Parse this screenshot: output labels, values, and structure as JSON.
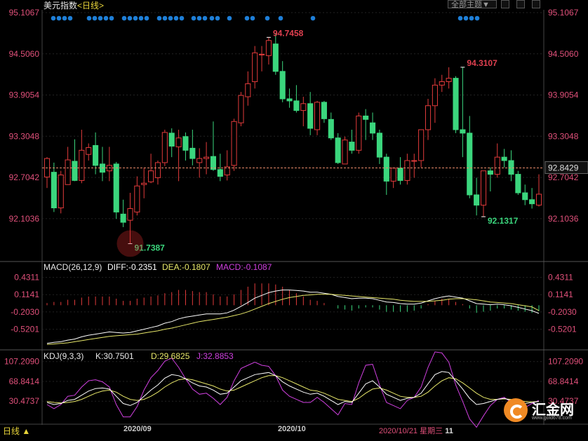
{
  "header": {
    "title": "美元指数",
    "period_tag": "<日线>",
    "filter_label": "全部主题▼"
  },
  "colors": {
    "up": "#e23b3b",
    "down": "#3bd67d",
    "background": "#000000",
    "diff": "#ffffff",
    "dea": "#e8e86a",
    "macd_pos": "#e23b3b",
    "macd_neg": "#3bd67d",
    "k": "#ffffff",
    "d": "#e8e86a",
    "j": "#d040e0",
    "dots": "#1e7fd8",
    "lastline": "#e88a6a"
  },
  "chart_data": [
    {
      "type": "candlestick",
      "title": "美元指数",
      "y_ticks": [
        "95.1067",
        "94.5060",
        "93.9054",
        "93.3048",
        "92.7042",
        "92.1036"
      ],
      "ylim": [
        91.55,
        95.1067
      ],
      "last_price": "92.8429",
      "annotations": {
        "high": "94.7458",
        "low": "91.7387",
        "local_high": "94.3107",
        "local_low": "92.1317"
      },
      "x_labels": [
        "2020/09",
        "2020/10"
      ],
      "cursor_label": {
        "date": "2020/10/21",
        "weekday": "星期三",
        "hour": "11"
      },
      "candles": [
        {
          "o": 92.71,
          "h": 93.0,
          "l": 92.55,
          "c": 92.98
        },
        {
          "o": 92.78,
          "h": 92.92,
          "l": 92.2,
          "c": 92.26
        },
        {
          "o": 92.26,
          "h": 92.8,
          "l": 92.18,
          "c": 92.74
        },
        {
          "o": 92.6,
          "h": 93.15,
          "l": 92.6,
          "c": 92.96
        },
        {
          "o": 92.94,
          "h": 93.26,
          "l": 92.65,
          "c": 92.66
        },
        {
          "o": 92.66,
          "h": 93.4,
          "l": 92.62,
          "c": 93.1
        },
        {
          "o": 93.04,
          "h": 93.2,
          "l": 92.95,
          "c": 93.14
        },
        {
          "o": 93.17,
          "h": 93.36,
          "l": 92.75,
          "c": 92.88
        },
        {
          "o": 92.9,
          "h": 93.15,
          "l": 92.65,
          "c": 92.78
        },
        {
          "o": 92.8,
          "h": 93.15,
          "l": 92.65,
          "c": 92.88
        },
        {
          "o": 92.9,
          "h": 92.93,
          "l": 92.1,
          "c": 92.2
        },
        {
          "o": 92.17,
          "h": 92.38,
          "l": 91.98,
          "c": 92.05
        },
        {
          "o": 92.08,
          "h": 92.48,
          "l": 91.74,
          "c": 92.25
        },
        {
          "o": 92.2,
          "h": 92.72,
          "l": 92.15,
          "c": 92.58
        },
        {
          "o": 92.6,
          "h": 92.85,
          "l": 92.4,
          "c": 92.62
        },
        {
          "o": 92.64,
          "h": 93.05,
          "l": 92.62,
          "c": 92.8
        },
        {
          "o": 92.7,
          "h": 92.95,
          "l": 92.6,
          "c": 92.92
        },
        {
          "o": 92.92,
          "h": 93.4,
          "l": 92.87,
          "c": 93.36
        },
        {
          "o": 93.35,
          "h": 93.42,
          "l": 93.0,
          "c": 93.16
        },
        {
          "o": 93.15,
          "h": 93.4,
          "l": 92.65,
          "c": 93.28
        },
        {
          "o": 93.3,
          "h": 93.36,
          "l": 92.95,
          "c": 93.1
        },
        {
          "o": 93.13,
          "h": 93.4,
          "l": 92.88,
          "c": 92.98
        },
        {
          "o": 92.92,
          "h": 93.13,
          "l": 92.7,
          "c": 92.98
        },
        {
          "o": 92.98,
          "h": 93.22,
          "l": 92.75,
          "c": 93.0
        },
        {
          "o": 93.01,
          "h": 93.52,
          "l": 92.8,
          "c": 92.82
        },
        {
          "o": 92.82,
          "h": 93.05,
          "l": 92.65,
          "c": 92.72
        },
        {
          "o": 92.74,
          "h": 93.1,
          "l": 92.66,
          "c": 92.86
        },
        {
          "o": 92.88,
          "h": 93.56,
          "l": 92.8,
          "c": 93.52
        },
        {
          "o": 93.5,
          "h": 93.95,
          "l": 93.45,
          "c": 93.9
        },
        {
          "o": 93.88,
          "h": 94.25,
          "l": 93.75,
          "c": 94.07
        },
        {
          "o": 94.1,
          "h": 94.62,
          "l": 94.0,
          "c": 94.52
        },
        {
          "o": 94.5,
          "h": 94.62,
          "l": 94.25,
          "c": 94.5
        },
        {
          "o": 94.48,
          "h": 94.75,
          "l": 94.35,
          "c": 94.7
        },
        {
          "o": 94.65,
          "h": 94.8,
          "l": 94.2,
          "c": 94.25
        },
        {
          "o": 94.25,
          "h": 94.4,
          "l": 93.8,
          "c": 93.85
        },
        {
          "o": 93.85,
          "h": 94.0,
          "l": 93.72,
          "c": 93.82
        },
        {
          "o": 93.82,
          "h": 94.05,
          "l": 93.65,
          "c": 93.68
        },
        {
          "o": 93.68,
          "h": 93.88,
          "l": 93.45,
          "c": 93.78
        },
        {
          "o": 93.78,
          "h": 93.95,
          "l": 93.32,
          "c": 93.42
        },
        {
          "o": 93.4,
          "h": 93.82,
          "l": 93.32,
          "c": 93.8
        },
        {
          "o": 93.8,
          "h": 93.82,
          "l": 93.5,
          "c": 93.56
        },
        {
          "o": 93.55,
          "h": 93.65,
          "l": 93.25,
          "c": 93.28
        },
        {
          "o": 93.28,
          "h": 93.35,
          "l": 92.9,
          "c": 92.92
        },
        {
          "o": 92.9,
          "h": 93.3,
          "l": 92.9,
          "c": 93.25
        },
        {
          "o": 93.22,
          "h": 93.4,
          "l": 93.05,
          "c": 93.1
        },
        {
          "o": 93.1,
          "h": 93.65,
          "l": 93.05,
          "c": 93.6
        },
        {
          "o": 93.6,
          "h": 93.7,
          "l": 93.25,
          "c": 93.55
        },
        {
          "o": 93.5,
          "h": 93.65,
          "l": 93.25,
          "c": 93.35
        },
        {
          "o": 93.35,
          "h": 93.4,
          "l": 92.9,
          "c": 93.0
        },
        {
          "o": 93.0,
          "h": 93.05,
          "l": 92.45,
          "c": 92.65
        },
        {
          "o": 92.65,
          "h": 92.85,
          "l": 92.55,
          "c": 92.84
        },
        {
          "o": 92.84,
          "h": 93.0,
          "l": 92.6,
          "c": 92.66
        },
        {
          "o": 92.66,
          "h": 93.05,
          "l": 92.6,
          "c": 92.95
        },
        {
          "o": 92.95,
          "h": 93.05,
          "l": 92.7,
          "c": 92.95
        },
        {
          "o": 92.95,
          "h": 93.35,
          "l": 92.85,
          "c": 93.4
        },
        {
          "o": 93.4,
          "h": 93.85,
          "l": 93.25,
          "c": 93.75
        },
        {
          "o": 93.75,
          "h": 94.15,
          "l": 93.5,
          "c": 94.05
        },
        {
          "o": 94.05,
          "h": 94.2,
          "l": 93.95,
          "c": 94.1
        },
        {
          "o": 94.1,
          "h": 94.31,
          "l": 94.0,
          "c": 94.15
        },
        {
          "o": 94.15,
          "h": 94.18,
          "l": 93.35,
          "c": 93.4
        },
        {
          "o": 93.4,
          "h": 94.31,
          "l": 93.0,
          "c": 93.35
        },
        {
          "o": 93.35,
          "h": 93.6,
          "l": 92.4,
          "c": 92.45
        },
        {
          "o": 92.45,
          "h": 92.7,
          "l": 92.15,
          "c": 92.3
        },
        {
          "o": 92.3,
          "h": 92.8,
          "l": 92.13,
          "c": 92.8
        },
        {
          "o": 92.8,
          "h": 92.85,
          "l": 92.5,
          "c": 92.75
        },
        {
          "o": 92.75,
          "h": 93.2,
          "l": 92.7,
          "c": 93.0
        },
        {
          "o": 93.0,
          "h": 93.12,
          "l": 92.85,
          "c": 92.95
        },
        {
          "o": 92.95,
          "h": 93.1,
          "l": 92.65,
          "c": 92.75
        },
        {
          "o": 92.75,
          "h": 92.8,
          "l": 92.45,
          "c": 92.48
        },
        {
          "o": 92.48,
          "h": 92.6,
          "l": 92.3,
          "c": 92.38
        },
        {
          "o": 92.38,
          "h": 92.55,
          "l": 92.25,
          "c": 92.32
        },
        {
          "o": 92.3,
          "h": 92.75,
          "l": 92.28,
          "c": 92.46
        }
      ]
    },
    {
      "type": "line",
      "title": "MACD(26,12,9)",
      "legend": [
        {
          "label": "DIFF:",
          "value": "-0.2351"
        },
        {
          "label": "DEA:",
          "value": "-0.1807"
        },
        {
          "label": "MACD:",
          "value": "-0.1087"
        }
      ],
      "y_ticks": [
        "0.4311",
        "0.1141",
        "-0.2030",
        "-0.5201"
      ],
      "ylim": [
        -0.86,
        0.58
      ],
      "diff": [
        -0.78,
        -0.76,
        -0.75,
        -0.72,
        -0.7,
        -0.66,
        -0.63,
        -0.61,
        -0.59,
        -0.57,
        -0.58,
        -0.59,
        -0.58,
        -0.55,
        -0.52,
        -0.49,
        -0.46,
        -0.41,
        -0.38,
        -0.33,
        -0.3,
        -0.28,
        -0.26,
        -0.24,
        -0.24,
        -0.24,
        -0.22,
        -0.17,
        -0.1,
        -0.03,
        0.05,
        0.1,
        0.15,
        0.18,
        0.2,
        0.2,
        0.19,
        0.18,
        0.16,
        0.16,
        0.14,
        0.12,
        0.08,
        0.06,
        0.04,
        0.05,
        0.05,
        0.04,
        0.01,
        -0.02,
        -0.03,
        -0.05,
        -0.06,
        -0.06,
        -0.04,
        0.0,
        0.04,
        0.07,
        0.09,
        0.07,
        0.05,
        0.0,
        -0.05,
        -0.06,
        -0.07,
        -0.06,
        -0.07,
        -0.09,
        -0.12,
        -0.15,
        -0.18,
        -0.23
      ],
      "dea": [
        -0.8,
        -0.79,
        -0.78,
        -0.77,
        -0.75,
        -0.73,
        -0.71,
        -0.69,
        -0.67,
        -0.65,
        -0.64,
        -0.63,
        -0.62,
        -0.61,
        -0.59,
        -0.57,
        -0.55,
        -0.52,
        -0.5,
        -0.47,
        -0.44,
        -0.41,
        -0.38,
        -0.36,
        -0.34,
        -0.32,
        -0.3,
        -0.27,
        -0.24,
        -0.2,
        -0.15,
        -0.1,
        -0.05,
        -0.01,
        0.03,
        0.06,
        0.08,
        0.1,
        0.11,
        0.12,
        0.12,
        0.12,
        0.11,
        0.1,
        0.09,
        0.08,
        0.07,
        0.06,
        0.05,
        0.04,
        0.03,
        0.01,
        0.0,
        -0.01,
        -0.01,
        -0.01,
        0.0,
        0.01,
        0.03,
        0.04,
        0.04,
        0.03,
        0.02,
        0.0,
        -0.02,
        -0.03,
        -0.04,
        -0.05,
        -0.07,
        -0.09,
        -0.11,
        -0.18
      ],
      "macd": [
        0.04,
        0.06,
        0.06,
        0.1,
        0.1,
        0.14,
        0.16,
        0.16,
        0.16,
        0.16,
        0.12,
        0.08,
        0.08,
        0.12,
        0.14,
        0.16,
        0.18,
        0.22,
        0.24,
        0.28,
        0.28,
        0.26,
        0.24,
        0.24,
        0.2,
        0.16,
        0.16,
        0.2,
        0.28,
        0.34,
        0.4,
        0.4,
        0.4,
        0.38,
        0.34,
        0.28,
        0.22,
        0.16,
        0.1,
        0.08,
        0.04,
        0.0,
        -0.06,
        -0.08,
        -0.1,
        -0.06,
        -0.04,
        -0.04,
        -0.08,
        -0.12,
        -0.12,
        -0.12,
        -0.12,
        -0.1,
        -0.06,
        0.02,
        0.08,
        0.12,
        0.12,
        0.06,
        0.02,
        -0.06,
        -0.14,
        -0.12,
        -0.1,
        -0.06,
        -0.06,
        -0.08,
        -0.1,
        -0.12,
        -0.14,
        -0.11
      ]
    },
    {
      "type": "line",
      "title": "KDJ(9,3,3)",
      "legend": [
        {
          "label": "K:",
          "value": "30.7501"
        },
        {
          "label": "D:",
          "value": "29.6825"
        },
        {
          "label": "J:",
          "value": "32.8853"
        }
      ],
      "y_ticks": [
        "107.2090",
        "68.8414",
        "30.4737"
      ],
      "ylim": [
        -10,
        115
      ],
      "k": [
        28,
        24,
        26,
        32,
        34,
        42,
        50,
        55,
        56,
        54,
        40,
        26,
        22,
        28,
        40,
        52,
        62,
        75,
        82,
        80,
        74,
        66,
        60,
        58,
        52,
        44,
        46,
        58,
        70,
        76,
        82,
        84,
        86,
        80,
        68,
        60,
        54,
        48,
        44,
        46,
        40,
        32,
        24,
        30,
        28,
        46,
        64,
        70,
        58,
        44,
        38,
        32,
        36,
        38,
        46,
        64,
        82,
        88,
        86,
        70,
        54,
        36,
        24,
        26,
        30,
        34,
        36,
        32,
        28,
        26,
        28,
        30
      ],
      "d": [
        30,
        28,
        27,
        28,
        30,
        34,
        40,
        46,
        50,
        52,
        48,
        40,
        34,
        32,
        34,
        40,
        48,
        58,
        66,
        72,
        74,
        72,
        68,
        64,
        60,
        54,
        50,
        52,
        58,
        64,
        70,
        76,
        80,
        80,
        76,
        70,
        64,
        58,
        52,
        50,
        46,
        40,
        34,
        32,
        30,
        36,
        46,
        54,
        56,
        52,
        46,
        40,
        38,
        38,
        40,
        48,
        60,
        70,
        76,
        74,
        66,
        56,
        46,
        38,
        34,
        34,
        35,
        34,
        32,
        30,
        29,
        30
      ],
      "j": [
        24,
        16,
        24,
        40,
        42,
        58,
        70,
        72,
        68,
        58,
        24,
        0,
        0,
        20,
        52,
        76,
        90,
        108,
        114,
        96,
        74,
        54,
        44,
        46,
        36,
        24,
        38,
        70,
        94,
        100,
        106,
        100,
        98,
        80,
        52,
        40,
        34,
        28,
        28,
        38,
        28,
        16,
        4,
        26,
        24,
        66,
        100,
        102,
        62,
        28,
        22,
        16,
        32,
        38,
        58,
        96,
        126,
        124,
        106,
        62,
        30,
        -4,
        -20,
        2,
        22,
        34,
        38,
        28,
        20,
        18,
        26,
        32
      ],
      "last_candle_color": "up"
    }
  ],
  "footer": {
    "period_label": "日线 ▲",
    "brand": "汇金网",
    "brand_url": "www.gold678.com"
  }
}
